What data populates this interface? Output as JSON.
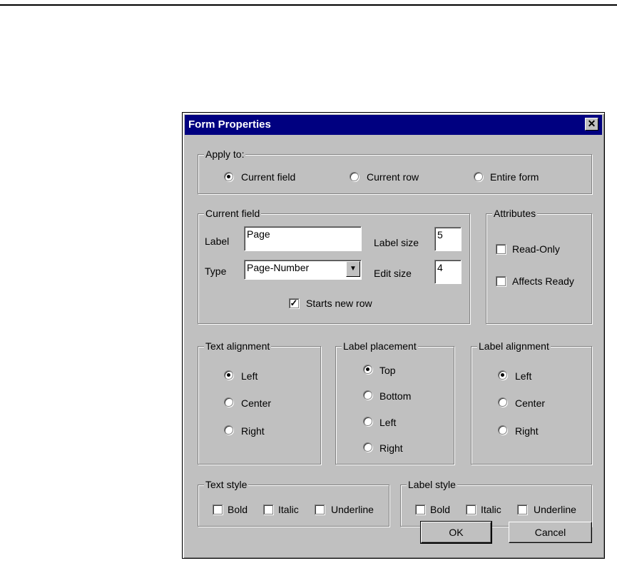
{
  "dialog": {
    "title": "Form Properties"
  },
  "apply_to": {
    "legend": "Apply to:",
    "options": [
      "Current field",
      "Current row",
      "Entire form"
    ],
    "selected": "Current field"
  },
  "current_field": {
    "legend": "Current field",
    "label_caption": "Label",
    "label_value": "Page",
    "type_caption": "Type",
    "type_value": "Page-Number",
    "label_size_caption": "Label size",
    "label_size_value": "5",
    "edit_size_caption": "Edit size",
    "edit_size_value": "4",
    "starts_new_row": "Starts new row",
    "starts_new_row_checked": true
  },
  "attributes": {
    "legend": "Attributes",
    "read_only": "Read-Only",
    "affects_ready": "Affects Ready"
  },
  "text_alignment": {
    "legend": "Text alignment",
    "options": [
      "Left",
      "Center",
      "Right"
    ],
    "selected": "Left"
  },
  "label_placement": {
    "legend": "Label placement",
    "options": [
      "Top",
      "Bottom",
      "Left",
      "Right"
    ],
    "selected": "Top"
  },
  "label_alignment": {
    "legend": "Label alignment",
    "options": [
      "Left",
      "Center",
      "Right"
    ],
    "selected": "Left"
  },
  "text_style": {
    "legend": "Text style",
    "bold": "Bold",
    "italic": "Italic",
    "underline": "Underline"
  },
  "label_style": {
    "legend": "Label style",
    "bold": "Bold",
    "italic": "Italic",
    "underline": "Underline"
  },
  "buttons": {
    "ok": "OK",
    "cancel": "Cancel"
  }
}
